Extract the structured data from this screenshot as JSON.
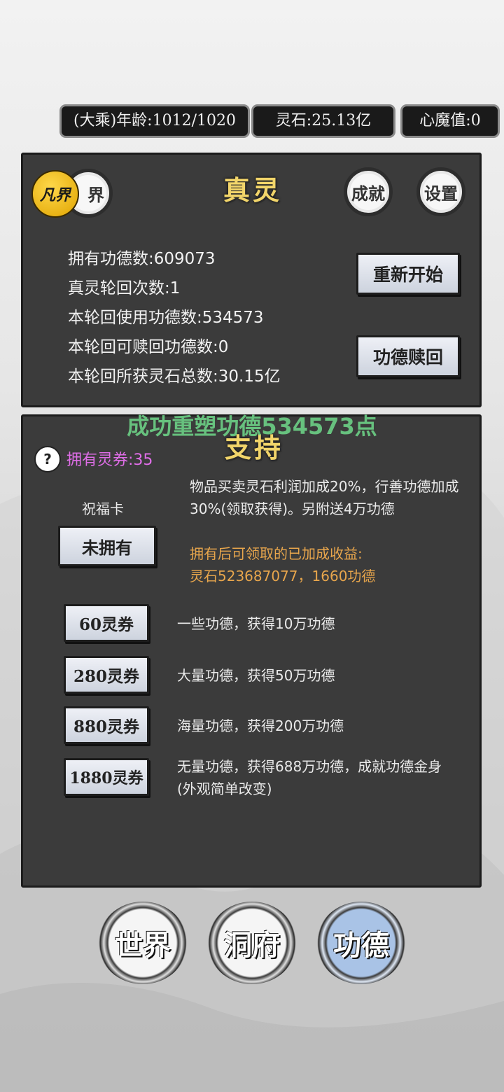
{
  "status_bar": {
    "age": "(大乘)年龄:1012/1020",
    "spirit_stones": "灵石:25.13亿",
    "heart_demon": "心魔值:0"
  },
  "top_panel": {
    "realm_badge": "凡界",
    "realm_tab": "界",
    "title": "真灵",
    "achievements_button": "成就",
    "settings_button": "设置",
    "stats": [
      "拥有功德数:609073",
      "真灵轮回次数:1",
      "本轮回使用功德数:534573",
      "本轮回可赎回功德数:0",
      "本轮回所获灵石总数:30.15亿"
    ],
    "restart_button": "重新开始",
    "redeem_button": "功德赎回"
  },
  "toast": "成功重塑功德534573点",
  "support_panel": {
    "title": "支持",
    "help_icon": "?",
    "coupons": "拥有灵券:35",
    "blessing_card": {
      "label": "祝福卡",
      "button": "未拥有",
      "desc": "物品买卖灵石利润加成20%，行善功德加成30%(领取获得)。另附送4万功德",
      "note_line1": "拥有后可领取的已加成收益:",
      "note_line2": "灵石523687077，1660功德"
    },
    "packs": [
      {
        "button": "60灵券",
        "desc": "一些功德，获得10万功德"
      },
      {
        "button": "280灵券",
        "desc": "大量功德，获得50万功德"
      },
      {
        "button": "880灵券",
        "desc": "海量功德，获得200万功德"
      },
      {
        "button": "1880灵券",
        "desc": "无量功德，获得688万功德，成就功德金身(外观简单改变)"
      }
    ]
  },
  "bottom_nav": {
    "world": "世界",
    "cave": "洞府",
    "merit": "功德"
  },
  "colors": {
    "title_gold": "#f2d56a",
    "coupon_purple": "#e06ee8",
    "note_orange": "#e8a64c",
    "toast_green": "#6fd98a",
    "active_nav": "#a9c3e6"
  }
}
